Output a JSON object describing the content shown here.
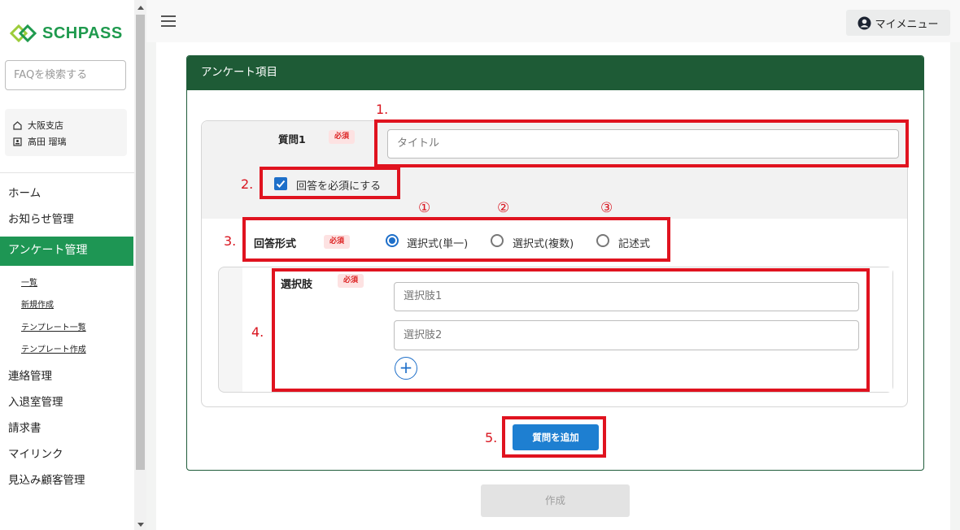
{
  "app": {
    "logo_text": "SCHPASS",
    "brand_color": "#1e9654"
  },
  "sidebar": {
    "search_placeholder": "FAQを検索する",
    "user": {
      "branch": "大阪支店",
      "name": "高田 瑠璃"
    },
    "nav": [
      {
        "label": "ホーム"
      },
      {
        "label": "お知らせ管理"
      },
      {
        "label": "アンケート管理",
        "active": true
      },
      {
        "label": "連絡管理"
      },
      {
        "label": "入退室管理"
      },
      {
        "label": "請求書"
      },
      {
        "label": "マイリンク"
      },
      {
        "label": "見込み顧客管理"
      }
    ],
    "subnav": [
      {
        "label": "一覧"
      },
      {
        "label": "新規作成"
      },
      {
        "label": "テンプレート一覧"
      },
      {
        "label": "テンプレート作成"
      }
    ]
  },
  "header": {
    "my_menu": "マイメニュー"
  },
  "card": {
    "title": "アンケート項目"
  },
  "question": {
    "label": "質問1",
    "required_badge": "必須",
    "title_placeholder": "タイトル",
    "required_checkbox_label": "回答を必須にする",
    "required_checked": true
  },
  "answer_format": {
    "label": "回答形式",
    "required_badge": "必須",
    "options": [
      {
        "label": "選択式(単一)",
        "selected": true
      },
      {
        "label": "選択式(複数)",
        "selected": false
      },
      {
        "label": "記述式",
        "selected": false
      }
    ]
  },
  "choices": {
    "label": "選択肢",
    "required_badge": "必須",
    "items": [
      {
        "placeholder": "選択肢1"
      },
      {
        "placeholder": "選択肢2"
      }
    ],
    "add_symbol": "+"
  },
  "buttons": {
    "add_question": "質問を追加",
    "create": "作成"
  },
  "annotations": {
    "numbers": [
      "1.",
      "2.",
      "3.",
      "4.",
      "5."
    ],
    "circled": [
      "①",
      "②",
      "③"
    ],
    "color": "#e0131f"
  }
}
